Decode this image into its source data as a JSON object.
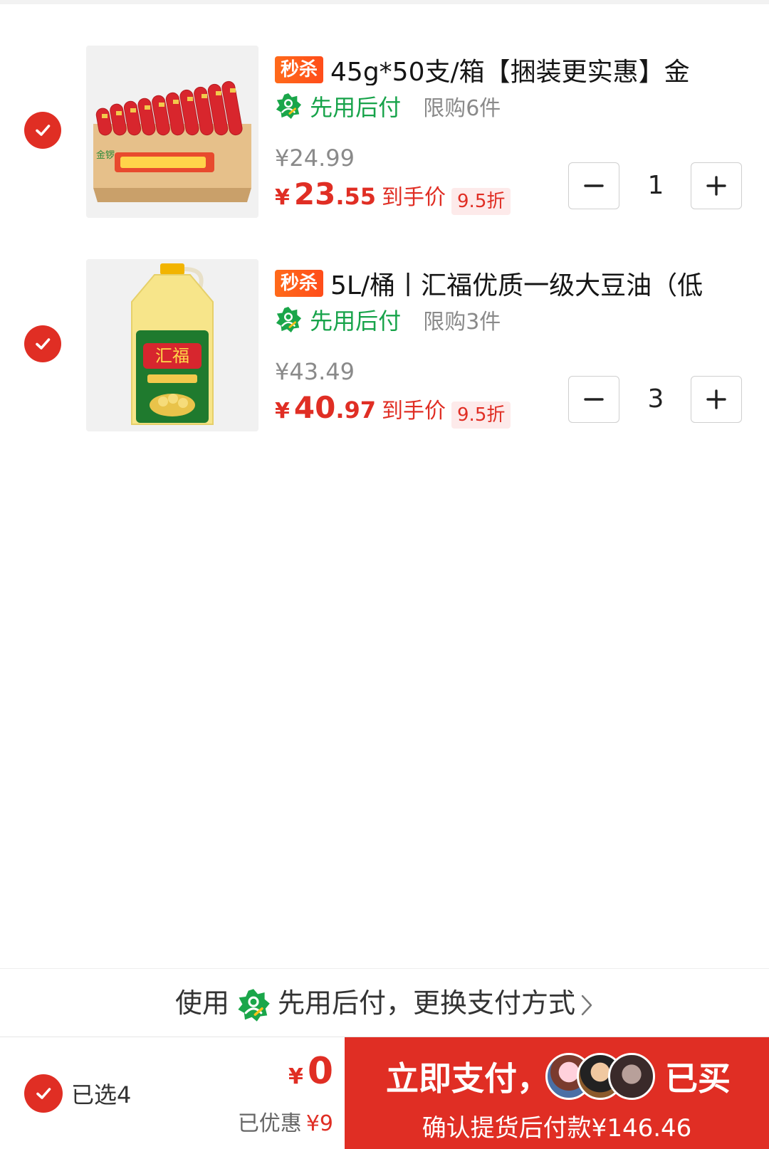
{
  "items": [
    {
      "tag": "秒杀",
      "title": "45g*50支/箱【捆装更实惠】金",
      "pay_later": "先用后付",
      "limit": "限购6件",
      "original_price": "¥24.99",
      "price_symbol": "¥",
      "price_int": "23",
      "price_dec": ".55",
      "price_label": "到手价",
      "discount": "9.5折",
      "quantity": "1",
      "product_image": "sausage-box-image"
    },
    {
      "tag": "秒杀",
      "title": "5L/桶丨汇福优质一级大豆油（低",
      "pay_later": "先用后付",
      "limit": "限购3件",
      "original_price": "¥43.49",
      "price_symbol": "¥",
      "price_int": "40",
      "price_dec": ".97",
      "price_label": "到手价",
      "discount": "9.5折",
      "quantity": "3",
      "product_image": "soybean-oil-bottle-image"
    }
  ],
  "payment_method": {
    "prefix": "使用",
    "text": "先用后付，更换支付方式"
  },
  "footer": {
    "selected": "已选4",
    "total_symbol": "¥",
    "total": "0",
    "saved_label": "已优惠",
    "saved_amount": "¥9",
    "pay_button": "立即支付，",
    "bought": "已买",
    "pay_sub": "确认提货后付款¥146.46"
  },
  "colors": {
    "accent_red": "#e02e24",
    "tag_orange": "#ff5a1a",
    "pay_later_green": "#17a34a"
  }
}
